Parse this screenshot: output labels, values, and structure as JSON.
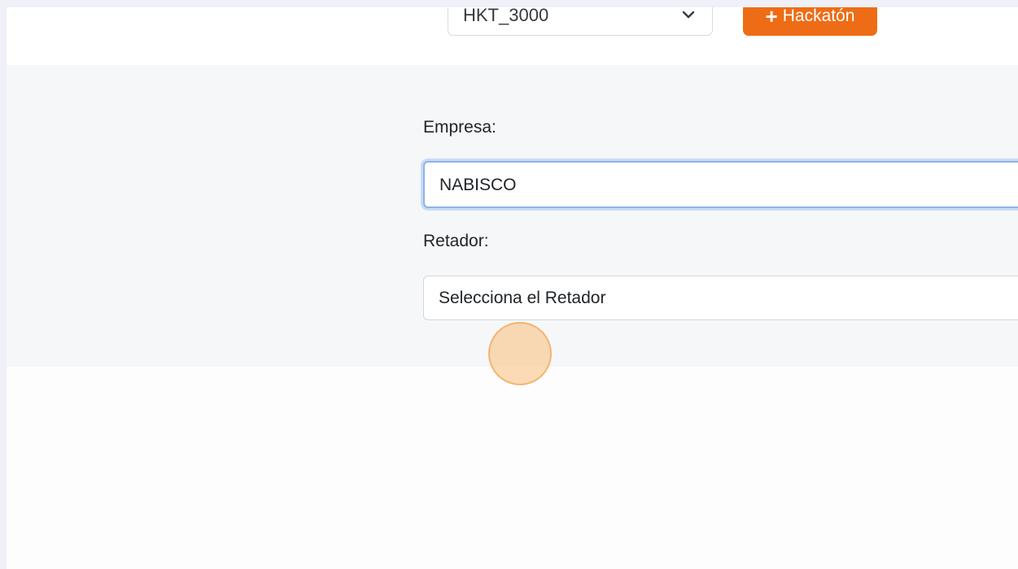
{
  "toolbar": {
    "hackathon_select": {
      "value": "HKT_3000",
      "chevron_icon": "chevron-down-icon"
    },
    "add_button": {
      "icon": "plus-icon",
      "label": "Hackatón"
    }
  },
  "form": {
    "empresa": {
      "label": "Empresa:",
      "value": "NABISCO"
    },
    "retador": {
      "label": "Retador:",
      "placeholder": "Selecciona el Retador"
    }
  },
  "colors": {
    "accent": "#ee6c16",
    "focus_border": "#8bb4ea",
    "click_highlight": "#f7bf78"
  }
}
